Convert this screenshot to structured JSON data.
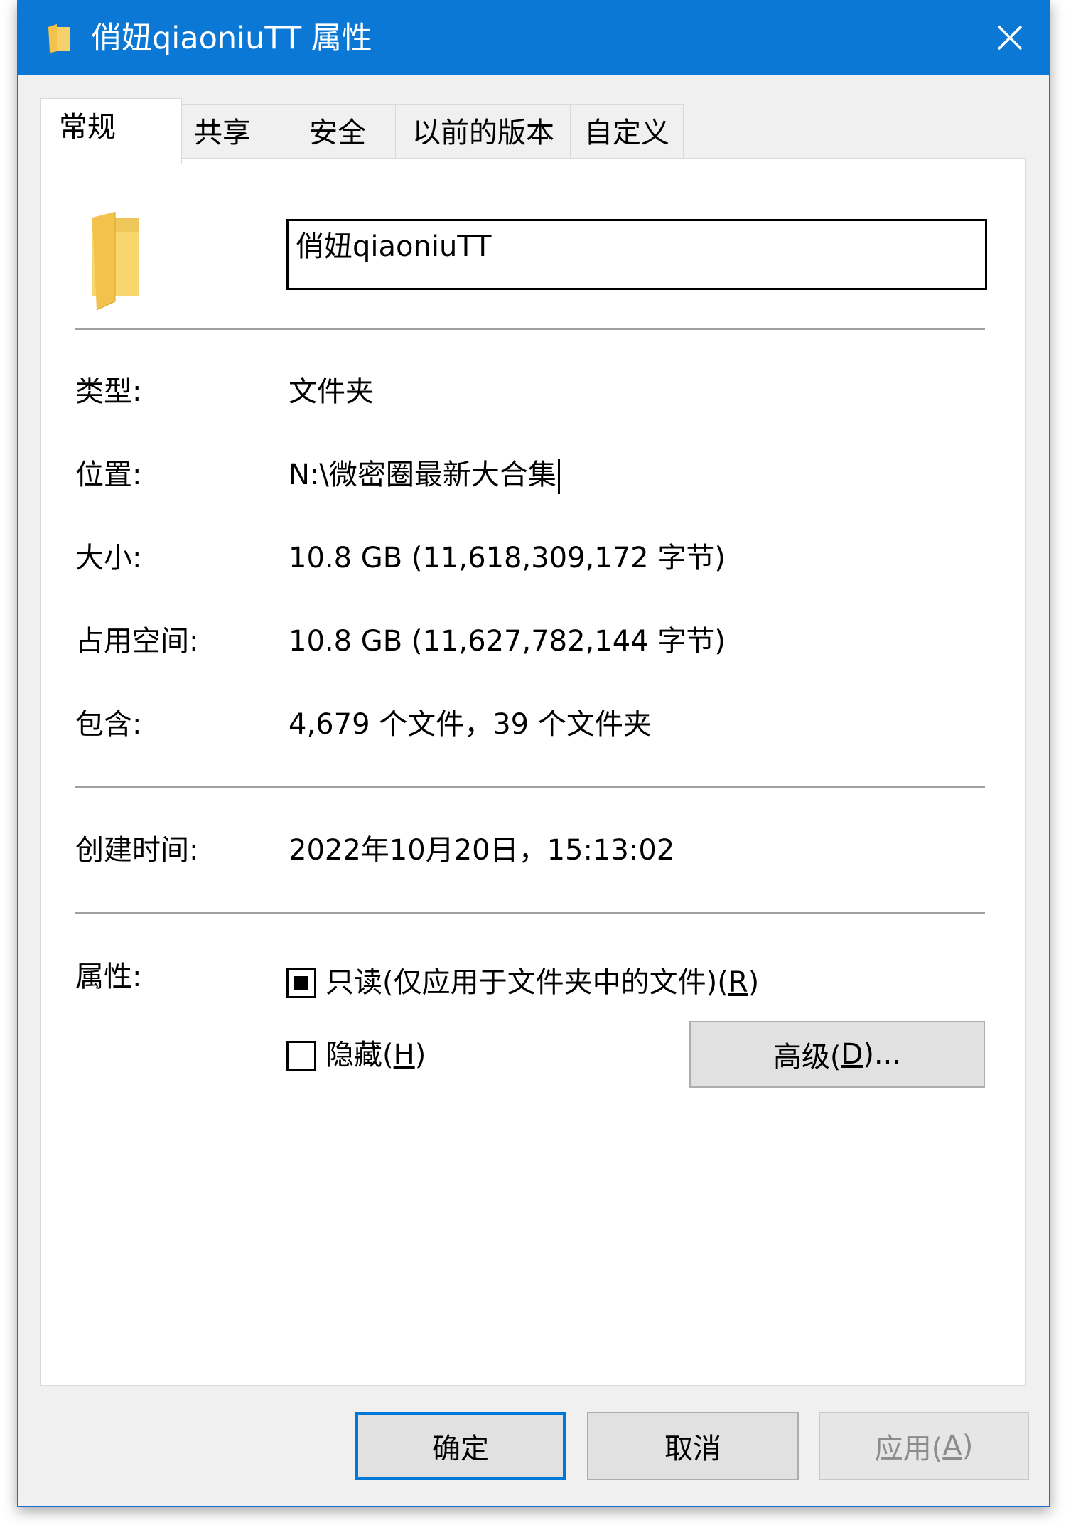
{
  "window": {
    "title": "俏妞qiaoniuTT 属性",
    "title_bar_color": "#0b78d6"
  },
  "tabs": [
    {
      "label": "常规",
      "active": true
    },
    {
      "label": "共享",
      "active": false
    },
    {
      "label": "安全",
      "active": false
    },
    {
      "label": "以前的版本",
      "active": false
    },
    {
      "label": "自定义",
      "active": false
    }
  ],
  "general": {
    "folder_name": "俏妞qiaoniuTT",
    "type_label": "类型:",
    "type_value": "文件夹",
    "location_label": "位置:",
    "location_value": "N:\\微密圈最新大合集",
    "size_label": "大小:",
    "size_value": "10.8 GB (11,618,309,172 字节)",
    "disk_label": "占用空间:",
    "disk_value": "10.8 GB (11,627,782,144 字节)",
    "contains_label": "包含:",
    "contains_value": "4,679 个文件，39 个文件夹",
    "created_label": "创建时间:",
    "created_value": "2022年10月20日，15:13:02",
    "attributes_label": "属性:",
    "readonly_text": "只读(仅应用于文件夹中的文件)(",
    "readonly_key": "R",
    "readonly_close": ")",
    "readonly_state": "indeterminate",
    "hidden_text": "隐藏(",
    "hidden_key": "H",
    "hidden_close": ")",
    "hidden_checked": false,
    "advanced_text": "高级(",
    "advanced_key": "D",
    "advanced_close": ")..."
  },
  "footer": {
    "ok_label": "确定",
    "cancel_label": "取消",
    "apply_text": "应用(",
    "apply_key": "A",
    "apply_close": ")",
    "apply_disabled": true
  },
  "icons": {
    "title": "folder-icon",
    "close": "close-icon",
    "folder": "folder-icon"
  },
  "colors": {
    "accent": "#0078d7",
    "folder_yellow": "#f5c94d"
  }
}
